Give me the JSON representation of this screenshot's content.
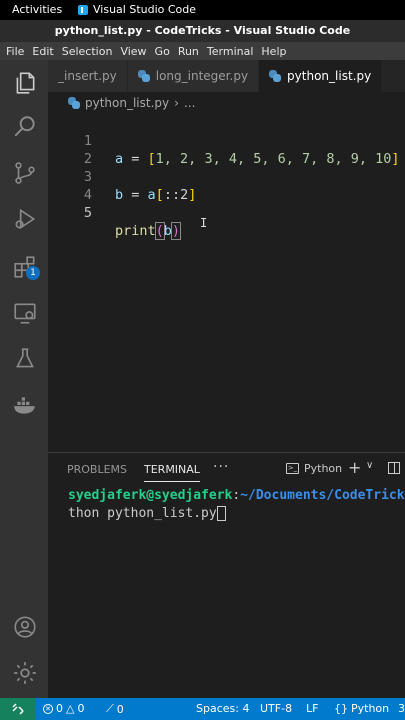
{
  "gnome": {
    "activities": "Activities",
    "app_name": "Visual Studio Code"
  },
  "window": {
    "title": "python_list.py - CodeTricks - Visual Studio Code"
  },
  "menu": [
    "File",
    "Edit",
    "Selection",
    "View",
    "Go",
    "Run",
    "Terminal",
    "Help"
  ],
  "tabs": [
    {
      "label": "_insert.py",
      "active": false
    },
    {
      "label": "long_integer.py",
      "active": false
    },
    {
      "label": "python_list.py",
      "active": true
    }
  ],
  "breadcrumb": {
    "file": "python_list.py",
    "more": "..."
  },
  "editor": {
    "line_numbers": [
      "1",
      "2",
      "3",
      "4",
      "5"
    ],
    "line1": {
      "var": "a",
      "op": " = ",
      "open": "[",
      "nums": "1, 2, 3, 4, 5, 6, 7, 8, 9, 10",
      "close": "]"
    },
    "line3": {
      "var_b": "b",
      "op": " = ",
      "var_a": "a",
      "open": "[",
      "slice": "::2",
      "close": "]"
    },
    "line5": {
      "fn": "print",
      "open": "(",
      "arg": "b",
      "close": ")"
    }
  },
  "panel": {
    "tabs": [
      "PROBLEMS",
      "TERMINAL"
    ],
    "active_tab": "TERMINAL",
    "more": "···",
    "terminal_type": "Python",
    "plus": "+",
    "chevron": "∨"
  },
  "terminal": {
    "user": "syedjaferk@syedjaferk",
    "sep": ":",
    "path": "~/Documents/CodeTricks",
    "line2": "thon python_list.py"
  },
  "status": {
    "errors": "0",
    "warnings": "0",
    "ports": "0",
    "spaces": "Spaces: 4",
    "encoding": "UTF-8",
    "eol": "LF",
    "language": "Python",
    "extra": "3"
  },
  "activity": {
    "extensions_badge": "1"
  },
  "colors": {
    "statusbar": "#007acc",
    "remote": "#16825d",
    "accent": "#0e70c0"
  }
}
